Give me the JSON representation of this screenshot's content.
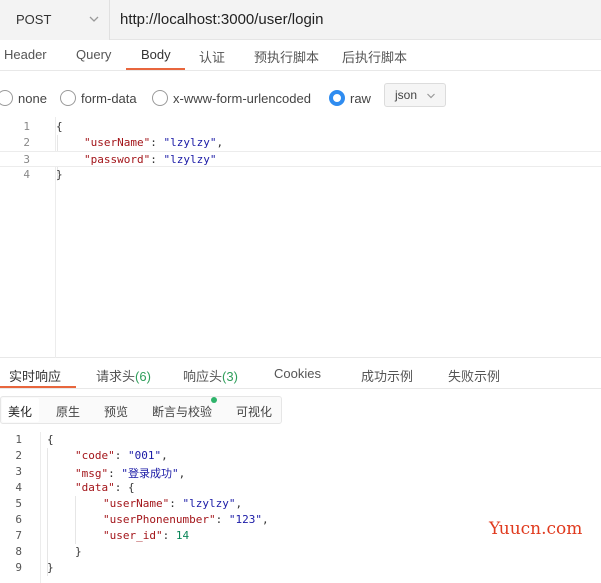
{
  "request": {
    "method": "POST",
    "url": "http://localhost:3000/user/login"
  },
  "request_tabs": [
    {
      "label": "Header"
    },
    {
      "label": "Query"
    },
    {
      "label": "Body"
    },
    {
      "label": "认证"
    },
    {
      "label": "预执行脚本"
    },
    {
      "label": "后执行脚本"
    }
  ],
  "active_request_tab": "Body",
  "body_types": [
    {
      "label": "none",
      "checked": false
    },
    {
      "label": "form-data",
      "checked": false
    },
    {
      "label": "x-www-form-urlencoded",
      "checked": false
    },
    {
      "label": "raw",
      "checked": true
    }
  ],
  "raw_format": "json",
  "request_body": {
    "line_numbers": [
      "1",
      "2",
      "3",
      "4"
    ],
    "key1": "\"userName\"",
    "val1": "\"lzylzy\"",
    "key2": "\"password\"",
    "val2": "\"lzylzy\"",
    "current_line": "3"
  },
  "response_tabs": [
    {
      "label": "实时响应"
    },
    {
      "label": "请求头",
      "count": "(6)"
    },
    {
      "label": "响应头",
      "count": "(3)"
    },
    {
      "label": "Cookies"
    },
    {
      "label": "成功示例"
    },
    {
      "label": "失败示例"
    }
  ],
  "active_response_tab": "实时响应",
  "view_modes": [
    {
      "label": "美化"
    },
    {
      "label": "原生"
    },
    {
      "label": "预览"
    },
    {
      "label": "断言与校验"
    },
    {
      "label": "可视化"
    }
  ],
  "active_view_mode": "美化",
  "response_body": {
    "line_numbers": [
      "1",
      "2",
      "3",
      "4",
      "5",
      "6",
      "7",
      "8",
      "9"
    ],
    "code_key": "\"code\"",
    "code_val": "\"001\"",
    "msg_key": "\"msg\"",
    "msg_val": "\"登录成功\"",
    "data_key": "\"data\"",
    "userName_key": "\"userName\"",
    "userName_val": "\"lzylzy\"",
    "phone_key": "\"userPhonenumber\"",
    "phone_val": "\"123\"",
    "id_key": "\"user_id\"",
    "id_val": "14"
  },
  "watermark": "Yuucn.com",
  "colors": {
    "accent": "#e8663d",
    "radio_checked": "#2f8cf0",
    "count_green": "#2e9e5a",
    "watermark": "#e03a1e"
  },
  "icons": {
    "method_dropdown": "chevron-down-icon",
    "format_dropdown": "chevron-down-icon",
    "assert_badge": "status-dot-icon"
  }
}
